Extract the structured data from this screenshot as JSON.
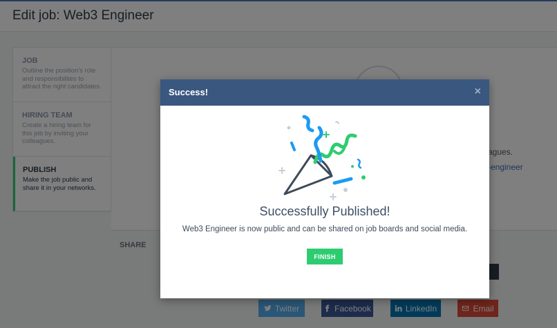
{
  "header": {
    "title": "Edit job: Web3 Engineer"
  },
  "steps": [
    {
      "title": "JOB",
      "desc": "Outline the position's role and responsibilites to attract the right candidates."
    },
    {
      "title": "HIRING TEAM",
      "desc": "Create a hiring team for this job by inviting your colleagues."
    },
    {
      "title": "PUBLISH",
      "desc": "Make the job public and share it in your networks."
    }
  ],
  "background": {
    "partial_text": "agues.",
    "partial_link": "-engineer"
  },
  "share": {
    "label": "SHARE",
    "buttons": {
      "twitter": "Twitter",
      "facebook": "Facebook",
      "linkedin": "LinkedIn",
      "email": "Email"
    }
  },
  "modal": {
    "title": "Success!",
    "close": "×",
    "heading": "Successfully Published!",
    "message": "Web3 Engineer is now public and can be shared on job boards and social media.",
    "finish_label": "FINISH"
  },
  "colors": {
    "modal_header": "#3a577f",
    "accent_green": "#2ecc71",
    "confetti_blue": "#1b9bf0",
    "confetti_green": "#2ecc71"
  }
}
